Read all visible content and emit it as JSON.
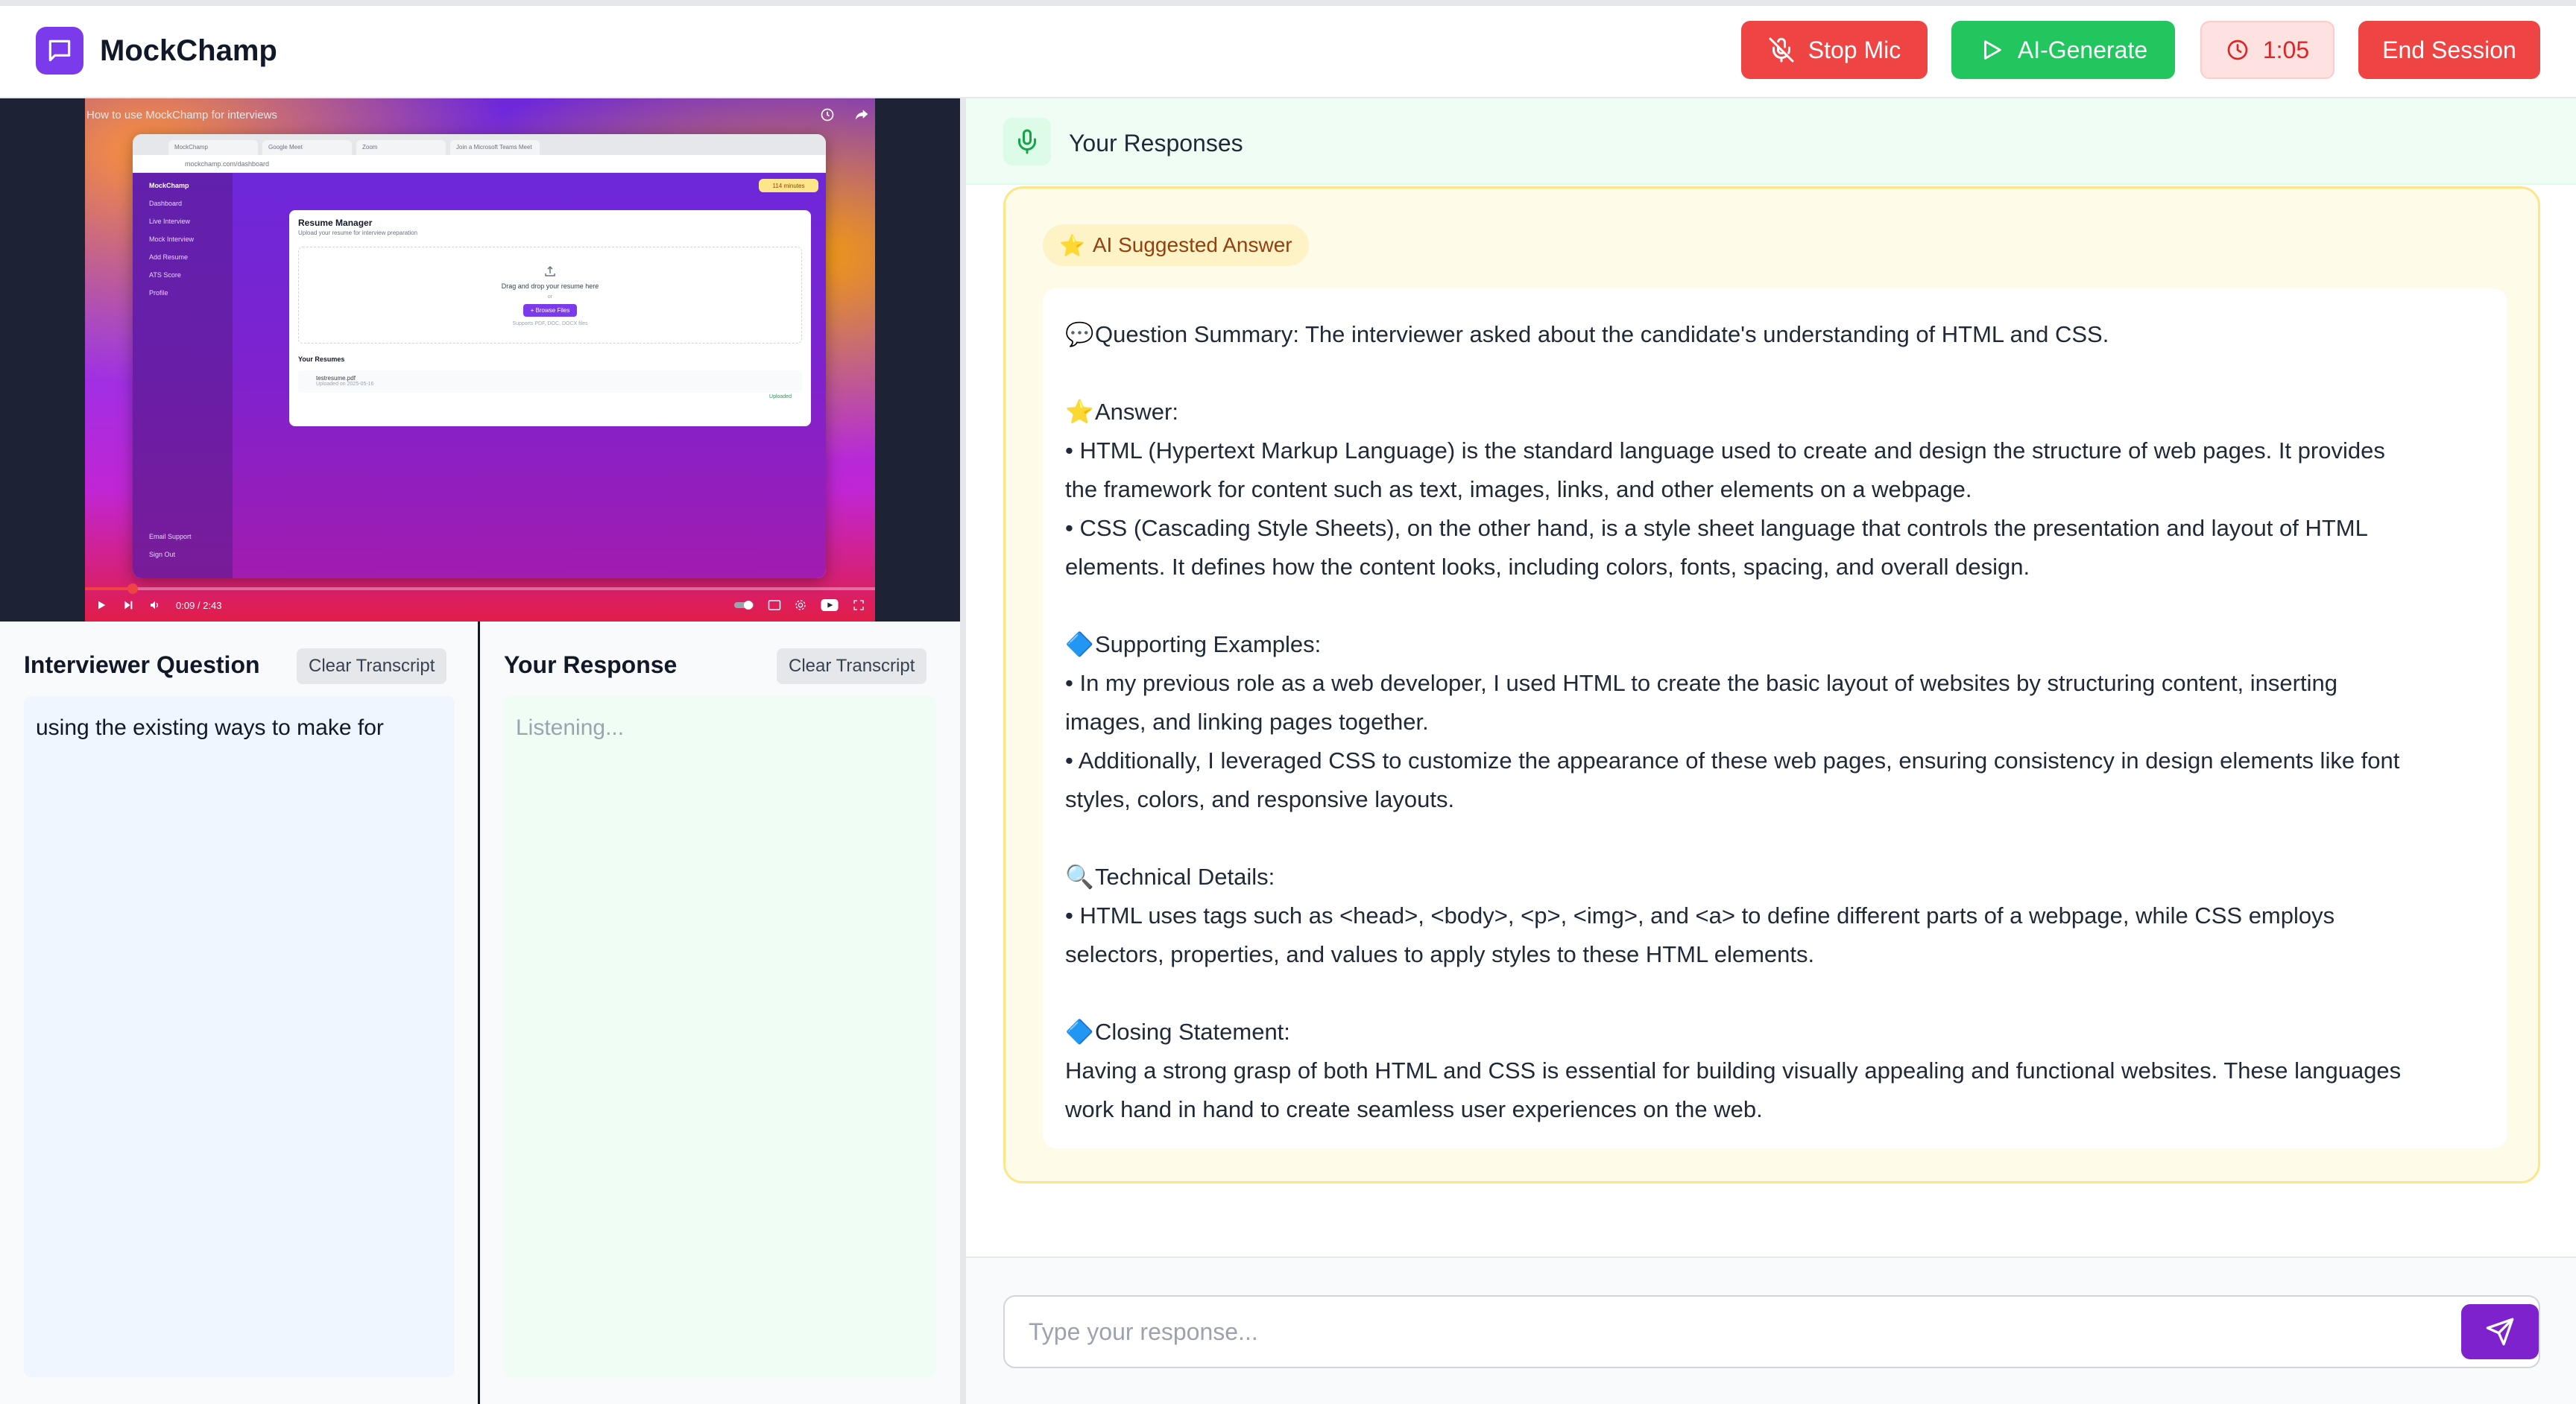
{
  "header": {
    "app_title": "MockChamp",
    "stop_mic_label": "Stop Mic",
    "ai_generate_label": "AI-Generate",
    "timer": "1:05",
    "end_session_label": "End Session"
  },
  "video": {
    "title": "How to use MockChamp for interviews",
    "time": "0:09 / 2:43",
    "progress_fraction": 0.06,
    "browser": {
      "tabs": [
        "MockChamp",
        "Google Meet",
        "Zoom",
        "Join a Microsoft Teams Meet"
      ],
      "url": "mockchamp.com/dashboard",
      "brand": "MockChamp",
      "badge": "114 minutes",
      "sidebar": [
        "Dashboard",
        "Live Interview",
        "Mock Interview",
        "Add Resume",
        "ATS Score",
        "Profile"
      ],
      "sidebar_bottom": [
        "Email Support",
        "Sign Out"
      ],
      "card_title": "Resume Manager",
      "card_subtitle": "Upload your resume for interview preparation",
      "drop_text": "Drag and drop your resume here",
      "or_text": "or",
      "choose_label": "+ Browse Files",
      "supports": "Supports PDF, DOC, DOCX files",
      "resumes_title": "Your Resumes",
      "resume_file": "testresume.pdf",
      "resume_date": "Uploaded on 2025-05-16",
      "resume_status": "Uploaded"
    }
  },
  "question_panel": {
    "title": "Interviewer Question",
    "clear_label": "Clear Transcript",
    "text": "using the existing ways to make for"
  },
  "response_panel": {
    "title": "Your Response",
    "clear_label": "Clear Transcript",
    "placeholder": "Listening..."
  },
  "responses": {
    "title": "Your Responses",
    "ai_chip": "AI Suggested Answer",
    "lines": [
      {
        "icon": "💬",
        "text": "Question Summary: The interviewer asked about the candidate's understanding of HTML and CSS."
      },
      {
        "icon": "",
        "text": ""
      },
      {
        "icon": "⭐",
        "text": "Answer:"
      },
      {
        "icon": "",
        "text": "• HTML (Hypertext Markup Language) is the standard language used to create and design the structure of web pages. It provides"
      },
      {
        "icon": "",
        "text": "the framework for content such as text, images, links, and other elements on a webpage."
      },
      {
        "icon": "",
        "text": "• CSS (Cascading Style Sheets), on the other hand, is a style sheet language that controls the presentation and layout of HTML"
      },
      {
        "icon": "",
        "text": "elements. It defines how the content looks, including colors, fonts, spacing, and overall design."
      },
      {
        "icon": "",
        "text": ""
      },
      {
        "icon": "🔷",
        "text": "Supporting Examples:"
      },
      {
        "icon": "",
        "text": "• In my previous role as a web developer, I used HTML to create the basic layout of websites by structuring content, inserting"
      },
      {
        "icon": "",
        "text": "images, and linking pages together."
      },
      {
        "icon": "",
        "text": "• Additionally, I leveraged CSS to customize the appearance of these web pages, ensuring consistency in design elements like font"
      },
      {
        "icon": "",
        "text": "styles, colors, and responsive layouts."
      },
      {
        "icon": "",
        "text": ""
      },
      {
        "icon": "🔍",
        "text": "Technical Details:"
      },
      {
        "icon": "",
        "text": "• HTML uses tags such as <head>, <body>, <p>, <img>, and <a> to define different parts of a webpage, while CSS employs"
      },
      {
        "icon": "",
        "text": "selectors, properties, and values to apply styles to these HTML elements."
      },
      {
        "icon": "",
        "text": ""
      },
      {
        "icon": "🔷",
        "text": "Closing Statement:"
      },
      {
        "icon": "",
        "text": "Having a strong grasp of both HTML and CSS is essential for building visually appealing and functional websites. These languages"
      },
      {
        "icon": "",
        "text": "work hand in hand to create seamless user experiences on the web."
      }
    ]
  },
  "input": {
    "placeholder": "Type your response..."
  },
  "colors": {
    "brand": "#7c3aed",
    "danger": "#ef4444",
    "success": "#22c55e",
    "send": "#7e22ce"
  },
  "icons": {
    "logo": "chat-bubble-icon",
    "stop_mic": "mic-off-icon",
    "ai_generate": "play-icon",
    "timer": "clock-icon",
    "responses": "mic-icon",
    "send": "send-icon"
  }
}
